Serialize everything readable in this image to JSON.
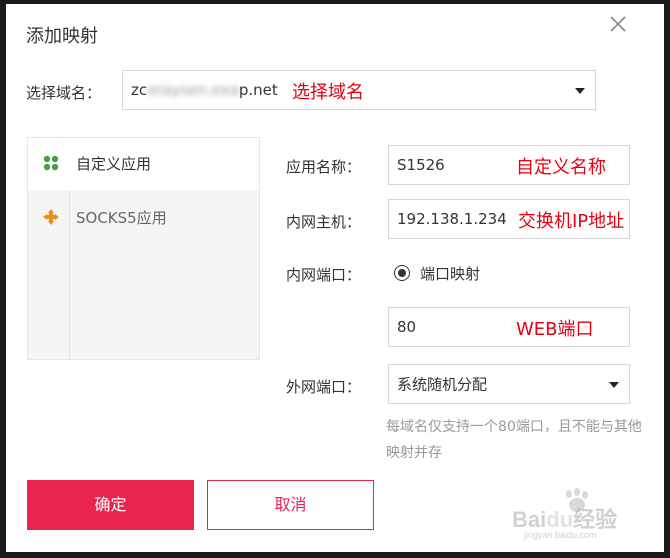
{
  "dialog": {
    "title": "添加映射",
    "close_icon": "close-icon"
  },
  "domain": {
    "label": "选择域名：",
    "value_prefix": "zc",
    "value_blurred": "oraysen.exa",
    "value_suffix": "p.net",
    "annotation": "选择域名"
  },
  "apps": [
    {
      "label": "自定义应用",
      "icon": "clover-icon",
      "active": true
    },
    {
      "label": "SOCKS5应用",
      "icon": "cross-arrows-icon",
      "active": false
    }
  ],
  "form": {
    "app_name": {
      "label": "应用名称：",
      "value": "S1526",
      "annotation": "自定义名称"
    },
    "intranet_host": {
      "label": "内网主机：",
      "value": "192.138.1.234",
      "annotation": "交换机IP地址"
    },
    "intranet_port": {
      "label": "内网端口：",
      "radio_label": "端口映射",
      "value": "80",
      "annotation": "WEB端口"
    },
    "external_port": {
      "label": "外网端口：",
      "selected": "系统随机分配"
    },
    "hint": "每域名仅支持一个80端口，且不能与其他映射并存"
  },
  "buttons": {
    "confirm": "确定",
    "cancel": "取消"
  },
  "watermark": {
    "brand_a": "Bai",
    "brand_b": "du",
    "brand_c": "经验",
    "sub": "jingyan.baidu.com"
  },
  "colors": {
    "accent": "#e8244f",
    "annotation": "#e60012",
    "clover": "#4a9e3f",
    "socks": "#f08c1e"
  }
}
